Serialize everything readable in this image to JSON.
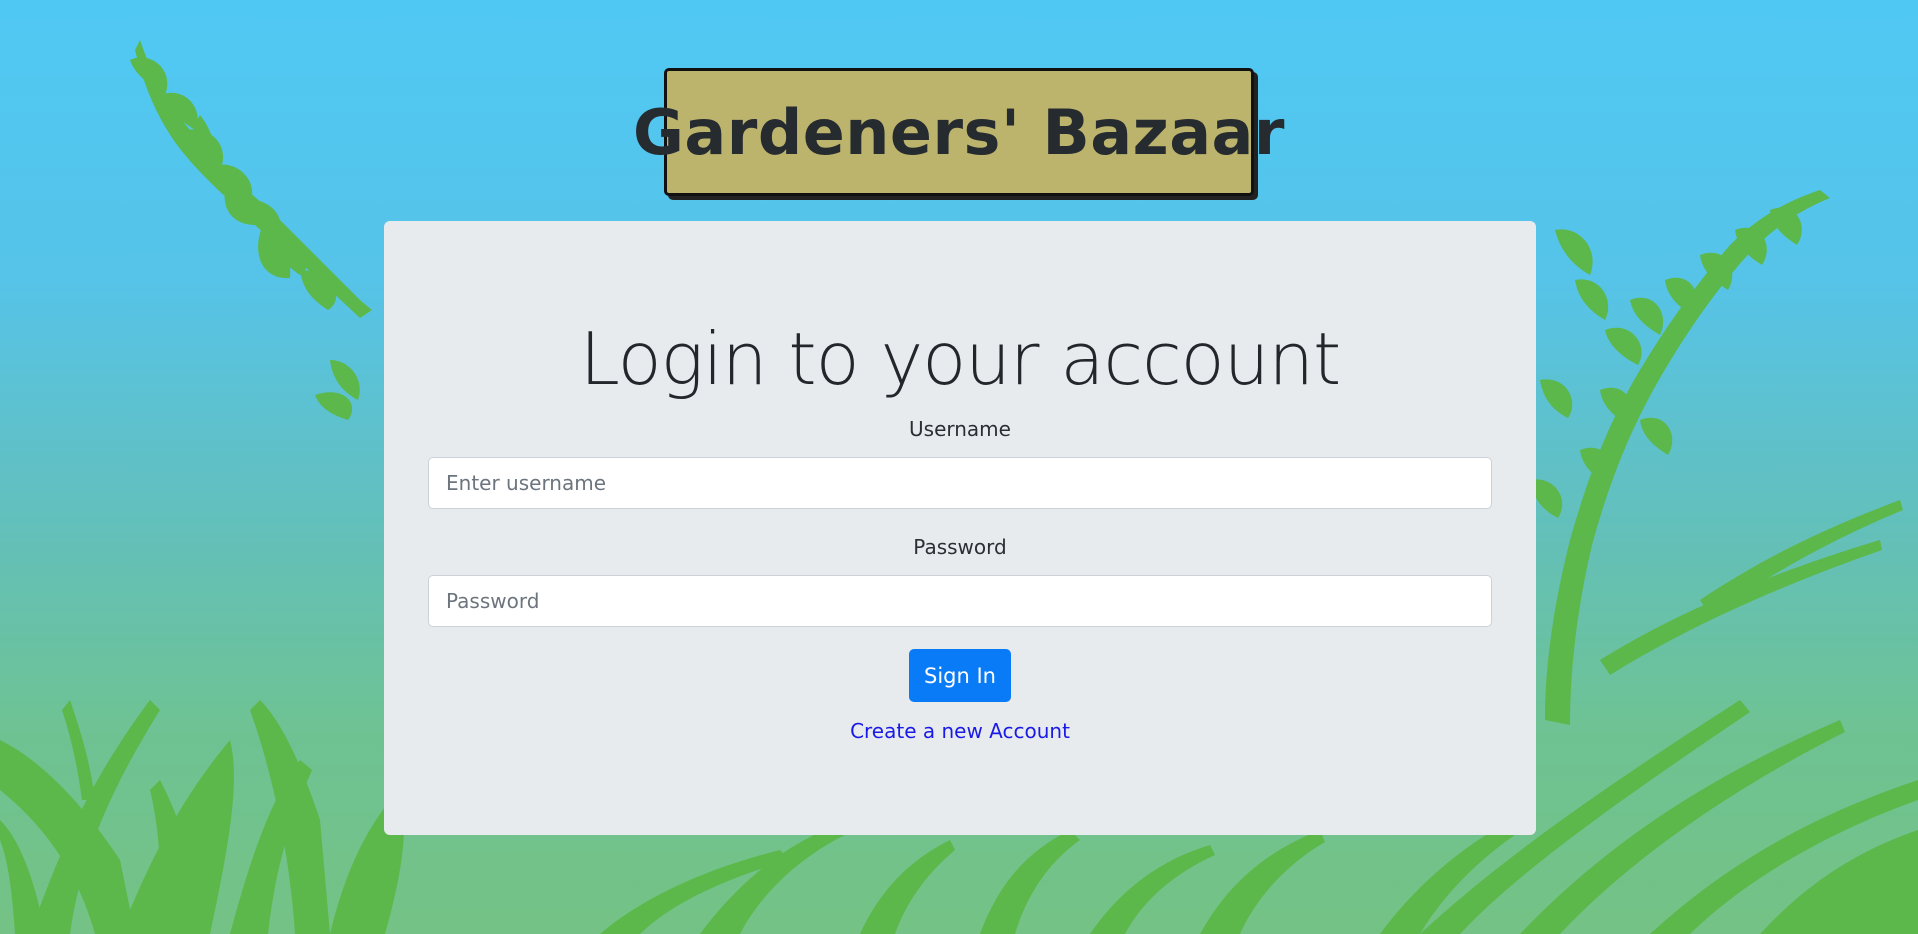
{
  "brand": {
    "title": "Gardeners' Bazaar",
    "box_color": "#bcb46d"
  },
  "login_form": {
    "heading": "Login to your account",
    "username": {
      "label": "Username",
      "placeholder": "Enter username",
      "value": ""
    },
    "password": {
      "label": "Password",
      "placeholder": "Password",
      "value": ""
    },
    "submit_label": "Sign In",
    "create_account_label": "Create a new Account"
  },
  "colors": {
    "sky": "#4fc9f4",
    "foliage": "#5cb84a",
    "card": "#e8ebee",
    "primary_button": "#0a7bf7",
    "link": "#1a1ae6"
  }
}
